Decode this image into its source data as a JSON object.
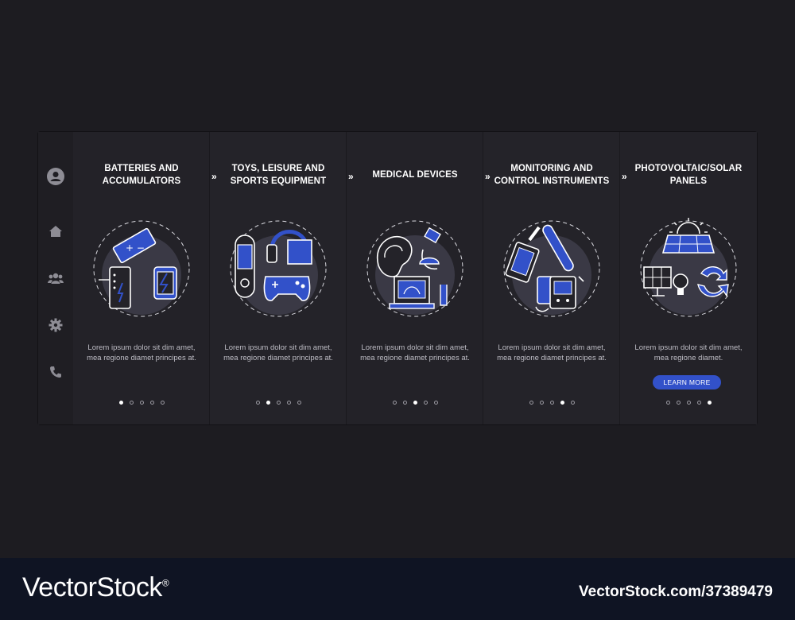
{
  "sidebar": {
    "icons": [
      "user-icon",
      "home-icon",
      "users-icon",
      "gear-icon",
      "phone-icon"
    ]
  },
  "screens": [
    {
      "title": "BATTERIES AND ACCUMULATORS",
      "description": "Lorem ipsum dolor sit dim amet, mea regione diamet principes at.",
      "active_dot": 1
    },
    {
      "title": "TOYS, LEISURE AND SPORTS EQUIPMENT",
      "description": "Lorem ipsum dolor sit dim amet, mea regione diamet principes at.",
      "active_dot": 2
    },
    {
      "title": "MEDICAL DEVICES",
      "description": "Lorem ipsum dolor sit dim amet, mea regione diamet principes at.",
      "active_dot": 3
    },
    {
      "title": "MONITORING AND CONTROL INSTRUMENTS",
      "description": "Lorem ipsum dolor sit dim amet, mea regione diamet principes at.",
      "active_dot": 4
    },
    {
      "title": "PHOTOVOLTAIC/SOLAR PANELS",
      "description": "Lorem ipsum dolor sit dim amet, mea regione diamet.",
      "active_dot": 5,
      "button_label": "LEARN MORE"
    }
  ],
  "arrow_glyph": "»",
  "footer": {
    "brand": "VectorStock",
    "brand_mark": "®",
    "image_id": "VectorStock.com/37389479"
  },
  "colors": {
    "accent": "#3251c9",
    "background": "#1d1c21",
    "panel": "#242329"
  }
}
